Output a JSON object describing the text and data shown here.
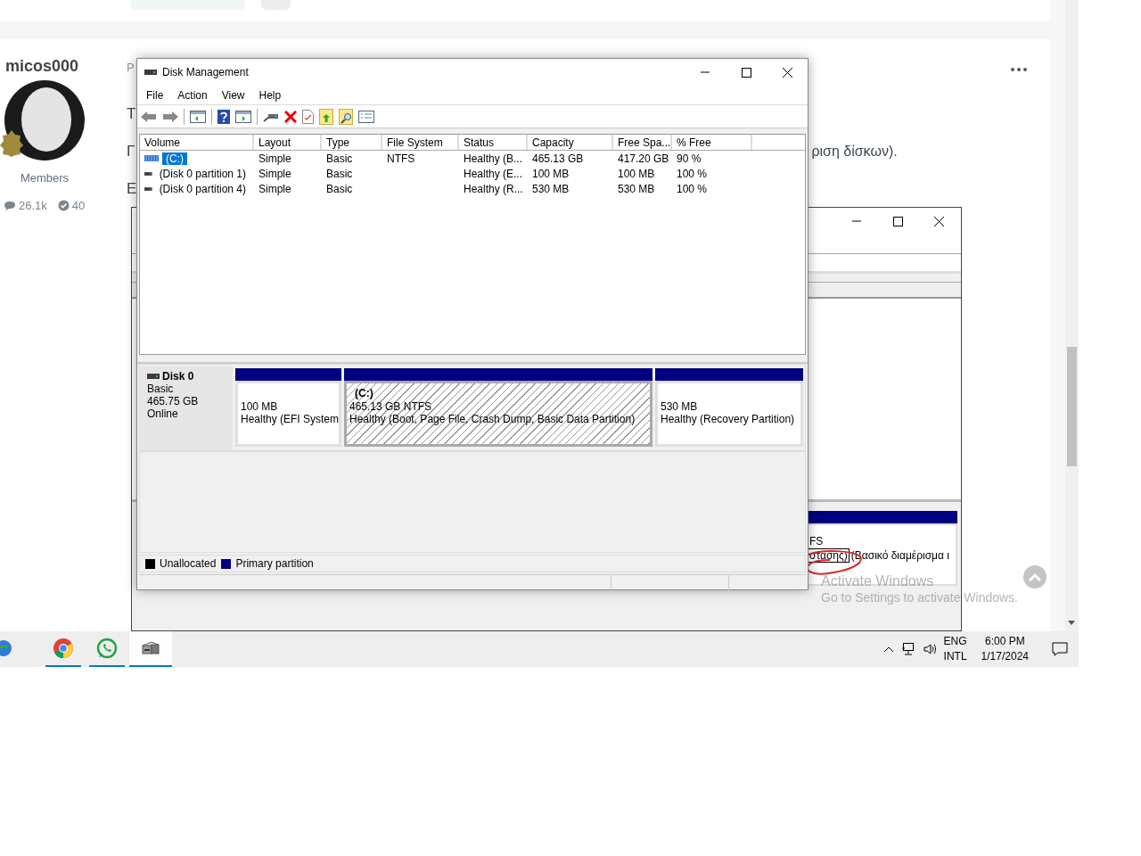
{
  "forum": {
    "username": "micos000",
    "role": "Members",
    "stats": [
      {
        "kind": "comments",
        "value": "26.1k"
      },
      {
        "kind": "reputation",
        "value": "40"
      }
    ],
    "post_lines": [
      {
        "lead": "P"
      },
      {
        "lead": "T"
      },
      {
        "lead": "Γ",
        "tail": "ριση δίσκων)."
      },
      {
        "lead": "Ε"
      }
    ]
  },
  "back_window": {
    "size_line": "FS",
    "status_parts": [
      {
        "text": "στασης)",
        "focused": true
      },
      {
        "text": "(Βασικό διαμέρισμα ι",
        "focused": false
      }
    ]
  },
  "disk_management": {
    "title": "Disk Management",
    "menu": [
      "File",
      "Action",
      "View",
      "Help"
    ],
    "columns": [
      "Volume",
      "Layout",
      "Type",
      "File System",
      "Status",
      "Capacity",
      "Free Spa...",
      "% Free"
    ],
    "rows": [
      {
        "kind": "striped",
        "selected": true,
        "cells": [
          "(C:)",
          "Simple",
          "Basic",
          "NTFS",
          "Healthy (B...",
          "465.13 GB",
          "417.20 GB",
          "90 %"
        ]
      },
      {
        "kind": "plain",
        "selected": false,
        "cells": [
          "(Disk 0 partition 1)",
          "Simple",
          "Basic",
          "",
          "Healthy (E...",
          "100 MB",
          "100 MB",
          "100 %"
        ]
      },
      {
        "kind": "plain",
        "selected": false,
        "cells": [
          "(Disk 0 partition 4)",
          "Simple",
          "Basic",
          "",
          "Healthy (R...",
          "530 MB",
          "530 MB",
          "100 %"
        ]
      }
    ],
    "disk": {
      "name": "Disk 0",
      "type": "Basic",
      "size": "465.75 GB",
      "status": "Online",
      "partitions": [
        {
          "selected": false,
          "lines": [
            "100 MB",
            "Healthy (EFI System"
          ]
        },
        {
          "selected": true,
          "name": "(C:)",
          "lines": [
            "465.13 GB NTFS",
            "Healthy (Boot, Page File, Crash Dump, Basic Data Partition)"
          ]
        },
        {
          "selected": false,
          "lines": [
            "530 MB",
            "Healthy (Recovery Partition)"
          ]
        }
      ]
    },
    "legend": [
      {
        "label": "Unallocated",
        "color": "#000000"
      },
      {
        "label": "Primary partition",
        "color": "#000080"
      }
    ]
  },
  "activation": {
    "title": "Activate Windows",
    "subtitle": "Go to Settings to activate Windows."
  },
  "taskbar": {
    "apps": [
      {
        "kind": "globe",
        "running": false,
        "selected": false
      },
      {
        "kind": "chrome",
        "running": true,
        "selected": false
      },
      {
        "kind": "whatsapp",
        "running": true,
        "selected": false
      },
      {
        "kind": "disk",
        "running": true,
        "selected": true
      }
    ],
    "language": [
      "ENG",
      "INTL"
    ],
    "time": "6:00 PM",
    "date": "1/17/2024"
  }
}
